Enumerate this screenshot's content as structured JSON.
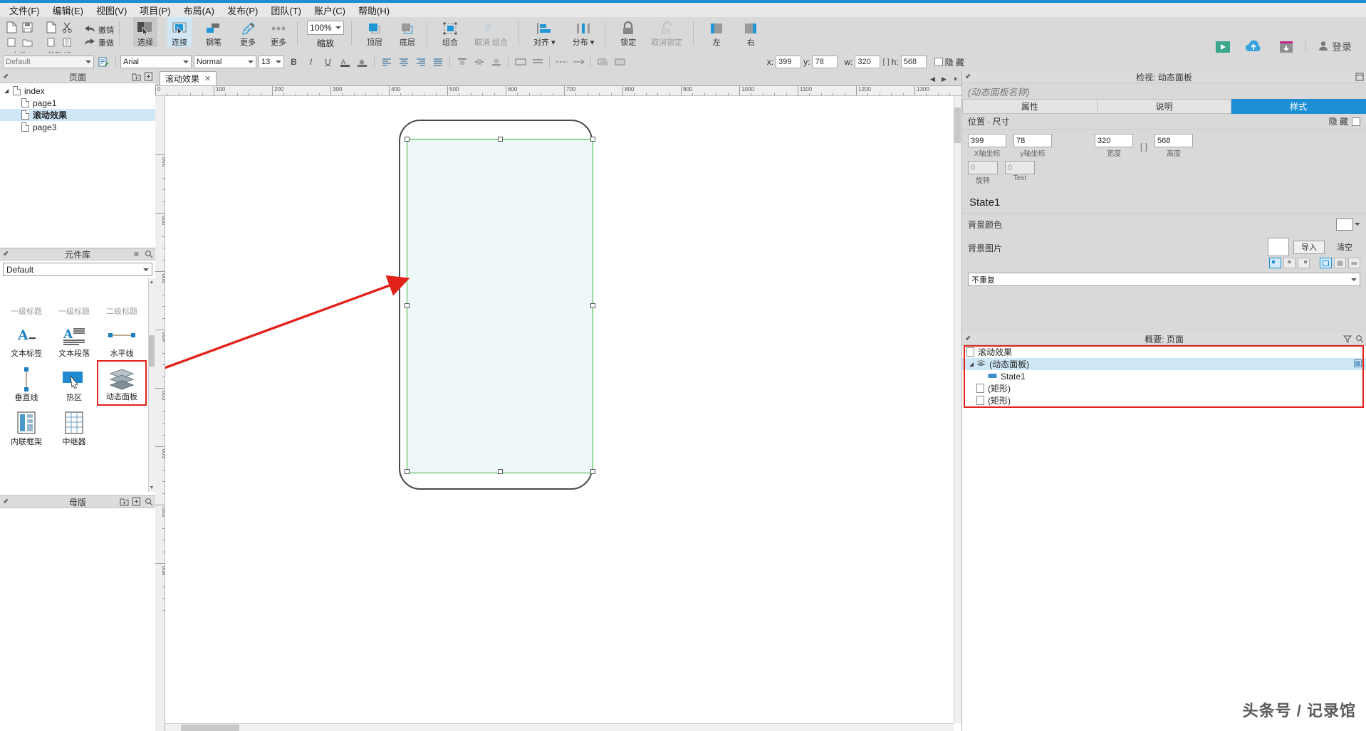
{
  "app": {
    "accent": "#1e8fd5"
  },
  "menu": {
    "items": [
      {
        "label": "文件(F)"
      },
      {
        "label": "编辑(E)"
      },
      {
        "label": "视图(V)"
      },
      {
        "label": "项目(P)"
      },
      {
        "label": "布局(A)"
      },
      {
        "label": "发布(P)"
      },
      {
        "label": "团队(T)"
      },
      {
        "label": "账户(C)"
      },
      {
        "label": "帮助(H)"
      }
    ]
  },
  "toolbar": {
    "file_group_label": "文件",
    "clipboard_group_label": "剪贴板",
    "undo_label": "撤销",
    "redo_label": "重做",
    "buttons": [
      {
        "name": "select",
        "label": "选择"
      },
      {
        "name": "connect",
        "label": "连接"
      },
      {
        "name": "pen",
        "label": "钢笔"
      },
      {
        "name": "more",
        "label": "更多"
      },
      {
        "name": "zoom",
        "label": "缩放"
      },
      {
        "name": "bring-to-front",
        "label": "顶层"
      },
      {
        "name": "send-to-back",
        "label": "底层"
      },
      {
        "name": "group",
        "label": "组合"
      },
      {
        "name": "ungroup",
        "label": "取消 组合"
      },
      {
        "name": "align",
        "label": "对齐"
      },
      {
        "name": "distribute",
        "label": "分布"
      },
      {
        "name": "lock",
        "label": "锁定"
      },
      {
        "name": "unlock",
        "label": "取消锁定"
      },
      {
        "name": "align-left",
        "label": "左"
      },
      {
        "name": "align-right",
        "label": "右"
      }
    ],
    "zoom_value": "100%",
    "preview_label": "预览",
    "share_label": "共享",
    "publish_label": "发布",
    "login_label": "登录"
  },
  "stylebar": {
    "widget_style": "Default",
    "font_family": "Arial",
    "font_weight": "Normal",
    "font_size": "13",
    "x_label": "x:",
    "x_value": "399",
    "y_label": "y:",
    "y_value": "78",
    "w_label": "w:",
    "w_value": "320",
    "h_label": "h:",
    "h_value": "568",
    "hidden_label": "隐 藏"
  },
  "pages_panel": {
    "title": "页面",
    "items": [
      {
        "label": "index",
        "depth": 0,
        "expanded": true,
        "selected": false
      },
      {
        "label": "page1",
        "depth": 1,
        "expanded": false,
        "selected": false
      },
      {
        "label": "滚动效果",
        "depth": 1,
        "expanded": false,
        "selected": true
      },
      {
        "label": "page3",
        "depth": 1,
        "expanded": false,
        "selected": false
      }
    ]
  },
  "library_panel": {
    "title": "元件库",
    "selected_library": "Default",
    "clipped_row": [
      {
        "label": "一级标题"
      },
      {
        "label": "一级标题"
      },
      {
        "label": "二级标题"
      }
    ],
    "items": [
      {
        "label": "文本标签",
        "icon": "text-label-icon",
        "highlighted": false
      },
      {
        "label": "文本段落",
        "icon": "text-paragraph-icon",
        "highlighted": false
      },
      {
        "label": "水平线",
        "icon": "horizontal-line-icon",
        "highlighted": false
      },
      {
        "label": "垂直线",
        "icon": "vertical-line-icon",
        "highlighted": false
      },
      {
        "label": "热区",
        "icon": "hotspot-icon",
        "highlighted": false
      },
      {
        "label": "动态面板",
        "icon": "dynamic-panel-icon",
        "highlighted": true
      },
      {
        "label": "内联框架",
        "icon": "inline-frame-icon",
        "highlighted": false
      },
      {
        "label": "中继器",
        "icon": "repeater-icon",
        "highlighted": false
      }
    ]
  },
  "masters_panel": {
    "title": "母版"
  },
  "canvas": {
    "tab_label": "滚动效果",
    "ruler_h_ticks": [
      "0",
      "100",
      "200",
      "300",
      "400",
      "500",
      "600",
      "700",
      "800",
      "900",
      "1000",
      "1100",
      "1200",
      "1300"
    ],
    "ruler_v_ticks": [
      "100",
      "200",
      "300",
      "400",
      "500",
      "600",
      "700",
      "800"
    ]
  },
  "inspector": {
    "title": "检视: 动态面板",
    "widget_name_placeholder": "(动态面板名称)",
    "tabs": [
      {
        "label": "属性",
        "active": false
      },
      {
        "label": "说明",
        "active": false
      },
      {
        "label": "样式",
        "active": true
      }
    ],
    "position_section": {
      "title": "位置 · 尺寸",
      "hidden_label": "隐 藏",
      "x": "399",
      "x_label": "X轴坐标",
      "y": "78",
      "y_label": "y轴坐标",
      "w": "320",
      "w_label": "宽度",
      "h": "568",
      "h_label": "高度",
      "rotate": "0",
      "rotate_label": "旋转",
      "text_rotate": "0",
      "text_rotate_label": "Text"
    },
    "state_label": "State1",
    "bg_color_label": "背景颜色",
    "bg_image_label": "背景图片",
    "import_label": "导入",
    "clear_label": "清空",
    "repeat_value": "不重复"
  },
  "outline_panel": {
    "title": "概要: 页面",
    "items": [
      {
        "label": "滚动效果",
        "depth": 0,
        "type": "page",
        "selected": false
      },
      {
        "label": "(动态面板)",
        "depth": 1,
        "type": "panel",
        "selected": true
      },
      {
        "label": "State1",
        "depth": 2,
        "type": "state",
        "selected": false
      },
      {
        "label": "(矩形)",
        "depth": 1,
        "type": "shape",
        "selected": false
      },
      {
        "label": "(矩形)",
        "depth": 1,
        "type": "shape",
        "selected": false
      }
    ]
  },
  "watermark": {
    "text": "头条号 / 记录馆"
  }
}
